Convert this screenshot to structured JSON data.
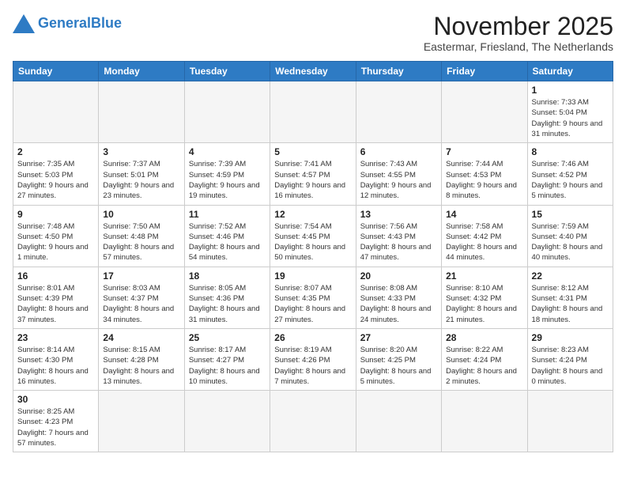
{
  "header": {
    "logo_text_general": "General",
    "logo_text_blue": "Blue",
    "month_title": "November 2025",
    "location": "Eastermar, Friesland, The Netherlands"
  },
  "weekdays": [
    "Sunday",
    "Monday",
    "Tuesday",
    "Wednesday",
    "Thursday",
    "Friday",
    "Saturday"
  ],
  "weeks": [
    [
      {
        "day": "",
        "empty": true
      },
      {
        "day": "",
        "empty": true
      },
      {
        "day": "",
        "empty": true
      },
      {
        "day": "",
        "empty": true
      },
      {
        "day": "",
        "empty": true
      },
      {
        "day": "",
        "empty": true
      },
      {
        "day": "1",
        "sunrise": "7:33 AM",
        "sunset": "5:04 PM",
        "daylight": "9 hours and 31 minutes."
      }
    ],
    [
      {
        "day": "2",
        "sunrise": "7:35 AM",
        "sunset": "5:03 PM",
        "daylight": "9 hours and 27 minutes."
      },
      {
        "day": "3",
        "sunrise": "7:37 AM",
        "sunset": "5:01 PM",
        "daylight": "9 hours and 23 minutes."
      },
      {
        "day": "4",
        "sunrise": "7:39 AM",
        "sunset": "4:59 PM",
        "daylight": "9 hours and 19 minutes."
      },
      {
        "day": "5",
        "sunrise": "7:41 AM",
        "sunset": "4:57 PM",
        "daylight": "9 hours and 16 minutes."
      },
      {
        "day": "6",
        "sunrise": "7:43 AM",
        "sunset": "4:55 PM",
        "daylight": "9 hours and 12 minutes."
      },
      {
        "day": "7",
        "sunrise": "7:44 AM",
        "sunset": "4:53 PM",
        "daylight": "9 hours and 8 minutes."
      },
      {
        "day": "8",
        "sunrise": "7:46 AM",
        "sunset": "4:52 PM",
        "daylight": "9 hours and 5 minutes."
      }
    ],
    [
      {
        "day": "9",
        "sunrise": "7:48 AM",
        "sunset": "4:50 PM",
        "daylight": "9 hours and 1 minute."
      },
      {
        "day": "10",
        "sunrise": "7:50 AM",
        "sunset": "4:48 PM",
        "daylight": "8 hours and 57 minutes."
      },
      {
        "day": "11",
        "sunrise": "7:52 AM",
        "sunset": "4:46 PM",
        "daylight": "8 hours and 54 minutes."
      },
      {
        "day": "12",
        "sunrise": "7:54 AM",
        "sunset": "4:45 PM",
        "daylight": "8 hours and 50 minutes."
      },
      {
        "day": "13",
        "sunrise": "7:56 AM",
        "sunset": "4:43 PM",
        "daylight": "8 hours and 47 minutes."
      },
      {
        "day": "14",
        "sunrise": "7:58 AM",
        "sunset": "4:42 PM",
        "daylight": "8 hours and 44 minutes."
      },
      {
        "day": "15",
        "sunrise": "7:59 AM",
        "sunset": "4:40 PM",
        "daylight": "8 hours and 40 minutes."
      }
    ],
    [
      {
        "day": "16",
        "sunrise": "8:01 AM",
        "sunset": "4:39 PM",
        "daylight": "8 hours and 37 minutes."
      },
      {
        "day": "17",
        "sunrise": "8:03 AM",
        "sunset": "4:37 PM",
        "daylight": "8 hours and 34 minutes."
      },
      {
        "day": "18",
        "sunrise": "8:05 AM",
        "sunset": "4:36 PM",
        "daylight": "8 hours and 31 minutes."
      },
      {
        "day": "19",
        "sunrise": "8:07 AM",
        "sunset": "4:35 PM",
        "daylight": "8 hours and 27 minutes."
      },
      {
        "day": "20",
        "sunrise": "8:08 AM",
        "sunset": "4:33 PM",
        "daylight": "8 hours and 24 minutes."
      },
      {
        "day": "21",
        "sunrise": "8:10 AM",
        "sunset": "4:32 PM",
        "daylight": "8 hours and 21 minutes."
      },
      {
        "day": "22",
        "sunrise": "8:12 AM",
        "sunset": "4:31 PM",
        "daylight": "8 hours and 18 minutes."
      }
    ],
    [
      {
        "day": "23",
        "sunrise": "8:14 AM",
        "sunset": "4:30 PM",
        "daylight": "8 hours and 16 minutes."
      },
      {
        "day": "24",
        "sunrise": "8:15 AM",
        "sunset": "4:28 PM",
        "daylight": "8 hours and 13 minutes."
      },
      {
        "day": "25",
        "sunrise": "8:17 AM",
        "sunset": "4:27 PM",
        "daylight": "8 hours and 10 minutes."
      },
      {
        "day": "26",
        "sunrise": "8:19 AM",
        "sunset": "4:26 PM",
        "daylight": "8 hours and 7 minutes."
      },
      {
        "day": "27",
        "sunrise": "8:20 AM",
        "sunset": "4:25 PM",
        "daylight": "8 hours and 5 minutes."
      },
      {
        "day": "28",
        "sunrise": "8:22 AM",
        "sunset": "4:24 PM",
        "daylight": "8 hours and 2 minutes."
      },
      {
        "day": "29",
        "sunrise": "8:23 AM",
        "sunset": "4:24 PM",
        "daylight": "8 hours and 0 minutes."
      }
    ],
    [
      {
        "day": "30",
        "sunrise": "8:25 AM",
        "sunset": "4:23 PM",
        "daylight": "7 hours and 57 minutes."
      },
      {
        "day": "",
        "empty": true
      },
      {
        "day": "",
        "empty": true
      },
      {
        "day": "",
        "empty": true
      },
      {
        "day": "",
        "empty": true
      },
      {
        "day": "",
        "empty": true
      },
      {
        "day": "",
        "empty": true
      }
    ]
  ]
}
